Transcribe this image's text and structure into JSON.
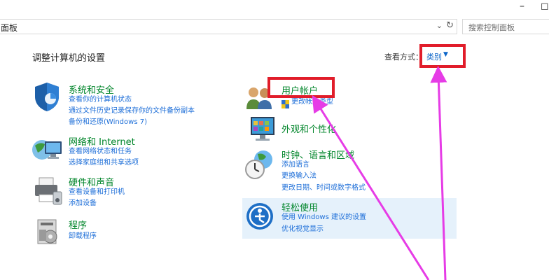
{
  "window": {
    "minimize_label": "–",
    "restore_label": "◻"
  },
  "address": {
    "path": "面板",
    "search_placeholder": "搜索控制面板"
  },
  "main": {
    "title": "调整计算机的设置",
    "view_by_label": "查看方式：",
    "view_by_value": "类别"
  },
  "categories_left": [
    {
      "title": "系统和安全",
      "icon": "shield-icon",
      "links": [
        "查看你的计算机状态",
        "通过文件历史记录保存你的文件备份副本",
        "备份和还原(Windows 7)"
      ]
    },
    {
      "title": "网络和 Internet",
      "icon": "network-globe-icon",
      "links": [
        "查看网络状态和任务",
        "选择家庭组和共享选项"
      ]
    },
    {
      "title": "硬件和声音",
      "icon": "printer-icon",
      "links": [
        "查看设备和打印机",
        "添加设备"
      ]
    },
    {
      "title": "程序",
      "icon": "programs-icon",
      "links": [
        "卸载程序"
      ]
    }
  ],
  "categories_right": [
    {
      "title": "用户帐户",
      "icon": "users-icon",
      "links": [
        "更改帐户类型"
      ]
    },
    {
      "title": "外观和个性化",
      "icon": "display-icon",
      "links": []
    },
    {
      "title": "时钟、语言和区域",
      "icon": "clock-globe-icon",
      "links": [
        "添加语言",
        "更换输入法",
        "更改日期、时间或数字格式"
      ]
    },
    {
      "title": "轻松使用",
      "icon": "ease-of-access-icon",
      "links": [
        "使用 Windows 建议的设置",
        "优化视觉显示"
      ]
    }
  ],
  "colors": {
    "category_title": "#00852a",
    "link": "#1d6ed8",
    "annotation": "#e11d2a",
    "arrow": "#e63ce6",
    "hover_bg": "#e5f1fb"
  }
}
